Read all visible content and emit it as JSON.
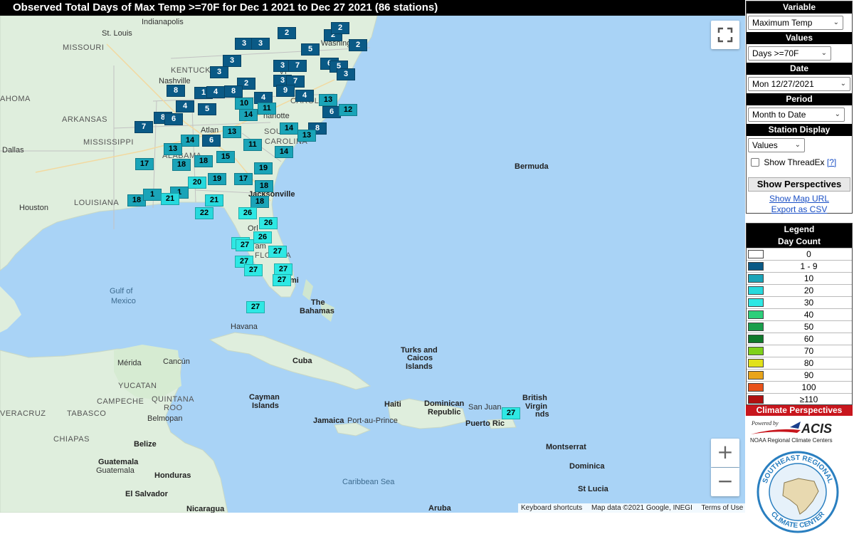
{
  "title": "Observed Total Days of Max Temp >=70F for Dec 1 2021 to Dec 27 2021 (86 stations)",
  "map": {
    "labels": {
      "indianapolis": "Indianapolis",
      "st_louis": "St. Louis",
      "missouri": "MISSOURI",
      "kentucky": "KENTUCKY",
      "nashville": "Nashville",
      "oklahoma": "AHOMA",
      "arkansas": "ARKANSAS",
      "mississippi": "MISSISSIPPI",
      "dallas": "Dallas",
      "louisiana": "LOUISIANA",
      "houston": "Houston",
      "alabama": "ALABAMA",
      "atlanta": "Atlan",
      "south_carolina": "SOU",
      "carolina": "CAROLINA",
      "charlotte": "harlotte",
      "virginia": "VI",
      "washington": "Washington",
      "jacksonville": "Jacksonville",
      "orlando": "Orl",
      "florida": "FLORIDA",
      "miami": "mi",
      "tampa": "Tam",
      "gulf": "Gulf of\nMexico",
      "gulf_1": "Gulf of",
      "gulf_2": "Mexico",
      "bermuda": "Bermuda",
      "bahamas_1": "The",
      "bahamas_2": "Bahamas",
      "havana": "Havana",
      "cuba": "Cuba",
      "turks_1": "Turks and",
      "turks_2": "Caicos",
      "turks_3": "Islands",
      "merida": "Mérida",
      "cancun": "Cancún",
      "yucatan": "YUCATAN",
      "campeche": "CAMPECHE",
      "quintana_1": "QUINTANA",
      "quintana_2": "ROO",
      "veracruz": "VERACRUZ",
      "tabasco": "TABASCO",
      "chiapas": "CHIAPAS",
      "belmopan": "Belmopan",
      "belize": "Belize",
      "guatemala_region": "Guatemala",
      "guatemala_city": "Guatemala",
      "honduras": "Honduras",
      "el_salvador": "El Salvador",
      "nicaragua": "Nicaragua",
      "cayman_1": "Cayman",
      "cayman_2": "Islands",
      "jamaica": "Jamaica",
      "port_au_prince": "Port-au-Prince",
      "haiti": "Haiti",
      "dominican_1": "Dominican",
      "dominican_2": "Republic",
      "san_juan": "San Juan",
      "puerto_rico": "Puerto Ric",
      "bvi_1": "British",
      "bvi_2": "Virgin",
      "bvi_3": "nds",
      "montserrat": "Montserrat",
      "dominica": "Dominica",
      "st_lucia": "St Lucia",
      "caribbean": "Caribbean Sea",
      "aruba": "Aruba"
    },
    "markers": [
      {
        "value": "2",
        "tone": "dark"
      },
      {
        "value": "2",
        "tone": "dark"
      },
      {
        "value": "2",
        "tone": "dark"
      },
      {
        "value": "3",
        "tone": "dark"
      },
      {
        "value": "3",
        "tone": "dark"
      },
      {
        "value": "2",
        "tone": "dark"
      },
      {
        "value": "5",
        "tone": "dark"
      },
      {
        "value": "3",
        "tone": "dark"
      },
      {
        "value": "3",
        "tone": "dark"
      },
      {
        "value": "3",
        "tone": "dark"
      },
      {
        "value": "7",
        "tone": "dark"
      },
      {
        "value": "6",
        "tone": "dark"
      },
      {
        "value": "5",
        "tone": "dark"
      },
      {
        "value": "3",
        "tone": "dark"
      },
      {
        "value": "3",
        "tone": "dark"
      },
      {
        "value": "7",
        "tone": "dark"
      },
      {
        "value": "2",
        "tone": "dark"
      },
      {
        "value": "8",
        "tone": "dark"
      },
      {
        "value": "1",
        "tone": "dark"
      },
      {
        "value": "4",
        "tone": "dark"
      },
      {
        "value": "8",
        "tone": "dark"
      },
      {
        "value": "4",
        "tone": "dark"
      },
      {
        "value": "9",
        "tone": "dark"
      },
      {
        "value": "4",
        "tone": "dark"
      },
      {
        "value": "4",
        "tone": "dark"
      },
      {
        "value": "5",
        "tone": "dark"
      },
      {
        "value": "10",
        "tone": "mid"
      },
      {
        "value": "11",
        "tone": "mid"
      },
      {
        "value": "13",
        "tone": "mid"
      },
      {
        "value": "6",
        "tone": "dark"
      },
      {
        "value": "12",
        "tone": "mid"
      },
      {
        "value": "8",
        "tone": "dark"
      },
      {
        "value": "6",
        "tone": "dark"
      },
      {
        "value": "14",
        "tone": "mid"
      },
      {
        "value": "7",
        "tone": "dark"
      },
      {
        "value": "13",
        "tone": "mid"
      },
      {
        "value": "14",
        "tone": "mid"
      },
      {
        "value": "8",
        "tone": "dark"
      },
      {
        "value": "14",
        "tone": "mid"
      },
      {
        "value": "13",
        "tone": "mid"
      },
      {
        "value": "6",
        "tone": "dark"
      },
      {
        "value": "13",
        "tone": "mid"
      },
      {
        "value": "11",
        "tone": "mid"
      },
      {
        "value": "15",
        "tone": "mid"
      },
      {
        "value": "14",
        "tone": "mid"
      },
      {
        "value": "18",
        "tone": "mid"
      },
      {
        "value": "17",
        "tone": "mid"
      },
      {
        "value": "18",
        "tone": "mid"
      },
      {
        "value": "19",
        "tone": "mid"
      },
      {
        "value": "19",
        "tone": "mid"
      },
      {
        "value": "17",
        "tone": "mid"
      },
      {
        "value": "18",
        "tone": "mid"
      },
      {
        "value": "20",
        "tone": "light"
      },
      {
        "value": "1",
        "tone": "mid"
      },
      {
        "value": "18",
        "tone": "mid"
      },
      {
        "value": "1",
        "tone": "mid"
      },
      {
        "value": "21",
        "tone": "light"
      },
      {
        "value": "21",
        "tone": "light"
      },
      {
        "value": "18",
        "tone": "mid"
      },
      {
        "value": "22",
        "tone": "light"
      },
      {
        "value": "26",
        "tone": "bright"
      },
      {
        "value": "26",
        "tone": "bright"
      },
      {
        "value": "26",
        "tone": "bright"
      },
      {
        "value": "26",
        "tone": "bright"
      },
      {
        "value": "27",
        "tone": "bright"
      },
      {
        "value": "27",
        "tone": "bright"
      },
      {
        "value": "27",
        "tone": "bright"
      },
      {
        "value": "27",
        "tone": "bright"
      },
      {
        "value": "27",
        "tone": "bright"
      },
      {
        "value": "27",
        "tone": "bright"
      },
      {
        "value": "27",
        "tone": "bright"
      },
      {
        "value": "27",
        "tone": "bright"
      }
    ],
    "attribution": {
      "keyboard": "Keyboard shortcuts",
      "map_data": "Map data ©2021 Google, INEGI",
      "terms": "Terms of Use"
    },
    "zoom_in": "+",
    "zoom_out": "−"
  },
  "controls": {
    "variable_heading": "Variable",
    "variable_value": "Maximum Temp",
    "values_heading": "Values",
    "values_value": "Days >=70F",
    "date_heading": "Date",
    "date_value": "Mon 12/27/2021",
    "period_heading": "Period",
    "period_value": "Month to Date",
    "station_heading": "Station Display",
    "station_value": "Values",
    "threadex_label": "Show ThreadEx",
    "threadex_help": "[?]",
    "show_perspectives": "Show Perspectives",
    "show_map_url": "Show Map URL",
    "export_csv": "Export as CSV"
  },
  "legend": {
    "heading": "Legend",
    "subheading": "Day Count",
    "rows": [
      {
        "label": "0",
        "color": "#ffffff"
      },
      {
        "label": "1 - 9",
        "color": "#0a5a86"
      },
      {
        "label": "10",
        "color": "#1aa4b8"
      },
      {
        "label": "20",
        "color": "#27d9dd"
      },
      {
        "label": "30",
        "color": "#2ee8e4"
      },
      {
        "label": "40",
        "color": "#2ccf7a"
      },
      {
        "label": "50",
        "color": "#1a9f4c"
      },
      {
        "label": "60",
        "color": "#0f7a2c"
      },
      {
        "label": "70",
        "color": "#7fd11b"
      },
      {
        "label": "80",
        "color": "#e2e21a"
      },
      {
        "label": "90",
        "color": "#e8a41a"
      },
      {
        "label": "100",
        "color": "#e8521a"
      },
      {
        "label": "≥110",
        "color": "#b01010"
      }
    ]
  },
  "footer": {
    "climate_perspectives": "Climate Perspectives",
    "acis_powered": "Powered by",
    "acis_name": "ACIS",
    "acis_sub": "NOAA Regional Climate Centers",
    "srcc_top": "SOUTHEAST REGIONAL",
    "srcc_bottom": "CLIMATE CENTER"
  }
}
